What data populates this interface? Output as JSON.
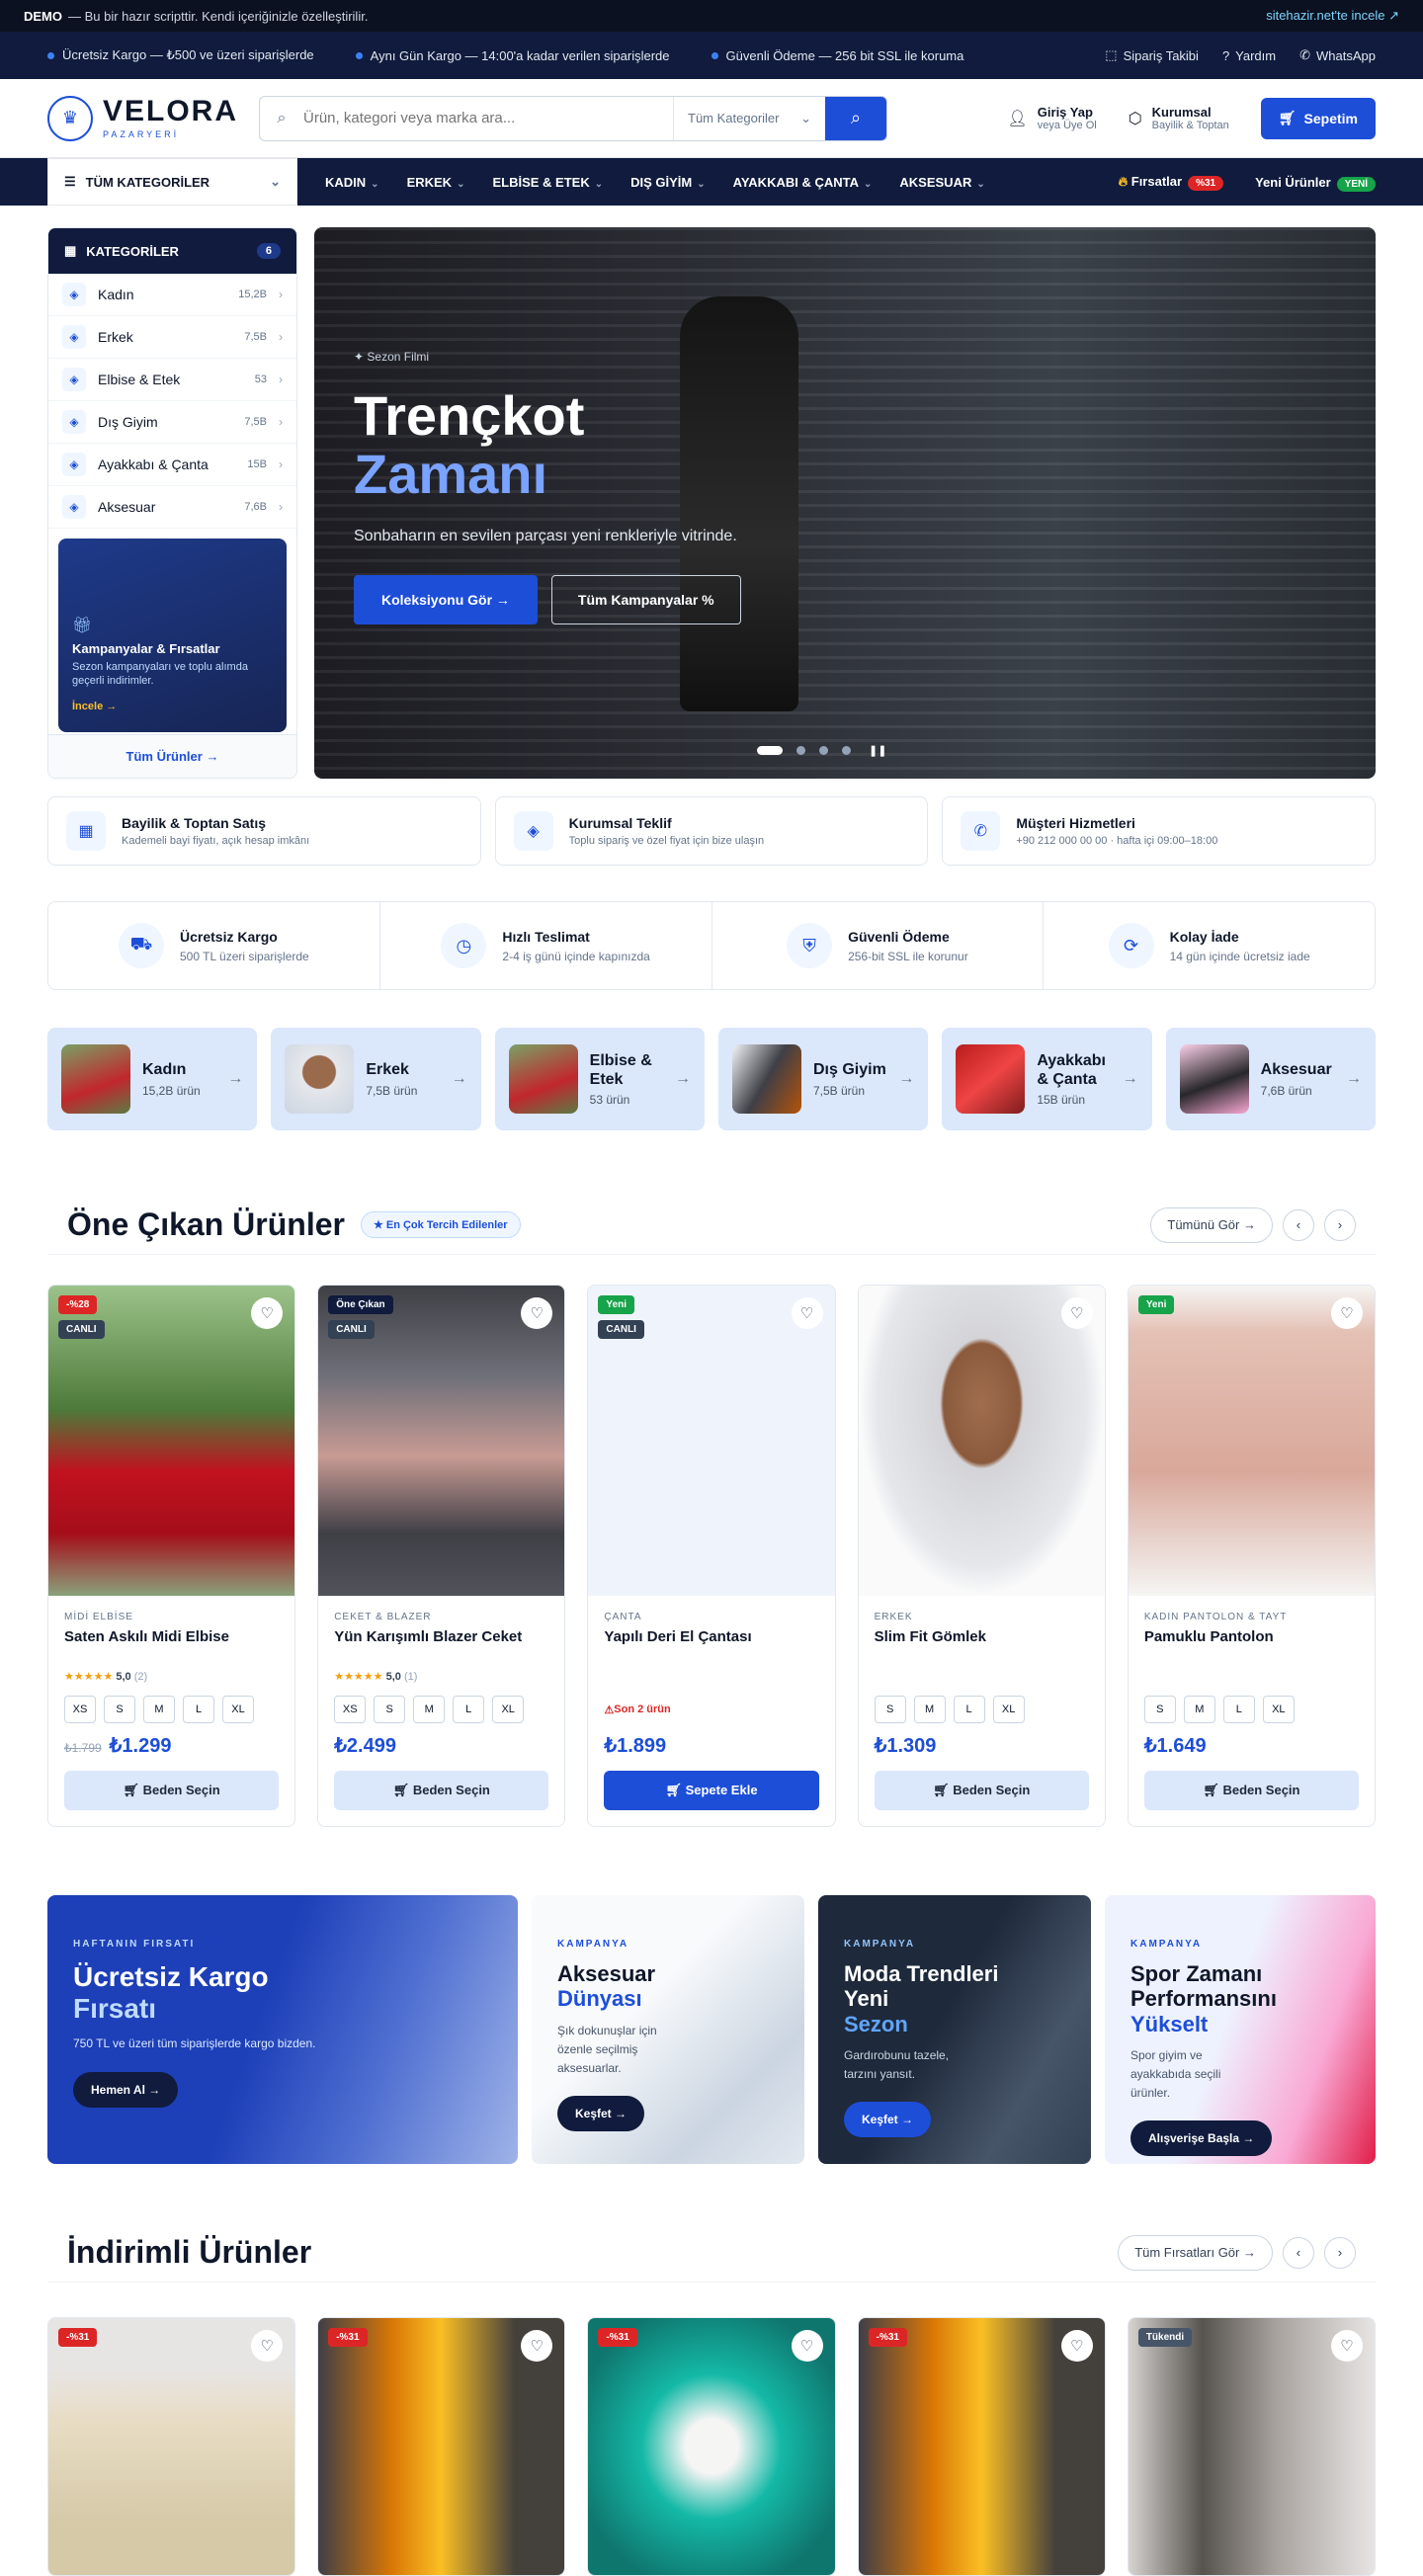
{
  "demo": {
    "label": "DEMO",
    "text": "— Bu bir hazır scripttir. Kendi içeriğinizle özelleştirilir.",
    "link": "sitehazir.net'te incele"
  },
  "ticker": {
    "items": [
      "Ücretsiz Kargo — ₺500 ve üzeri siparişlerde",
      "Aynı Gün Kargo — 14:00'a kadar verilen siparişlerde",
      "Güvenli Ödeme — 256 bit SSL ile koruma"
    ],
    "links": [
      "Sipariş Takibi",
      "Yardım",
      "WhatsApp"
    ]
  },
  "header": {
    "brand": "VELORA",
    "brand_sub": "PAZARYERİ",
    "search_placeholder": "Ürün, kategori veya marka ara...",
    "search_category": "Tüm Kategoriler",
    "login": "Giriş Yap",
    "login_sub": "veya Üye Ol",
    "corporate": "Kurumsal",
    "corporate_sub": "Bayilik & Toptan",
    "cart": "Sepetim"
  },
  "nav": {
    "all_categories": "TÜM KATEGORİLER",
    "links": [
      "KADIN",
      "ERKEK",
      "ELBİSE & ETEK",
      "DIŞ GİYİM",
      "AYAKKABI & ÇANTA",
      "AKSESUAR"
    ],
    "deals": "Fırsatlar",
    "deals_badge": "%31",
    "new": "Yeni Ürünler",
    "new_badge": "YENİ"
  },
  "sidebar": {
    "title": "KATEGORİLER",
    "count": "6",
    "items": [
      {
        "label": "Kadın",
        "count": "15,2B"
      },
      {
        "label": "Erkek",
        "count": "7,5B"
      },
      {
        "label": "Elbise & Etek",
        "count": "53"
      },
      {
        "label": "Dış Giyim",
        "count": "7,5B"
      },
      {
        "label": "Ayakkabı & Çanta",
        "count": "15B"
      },
      {
        "label": "Aksesuar",
        "count": "7,6B"
      }
    ],
    "promo_title": "Kampanyalar & Fırsatlar",
    "promo_desc": "Sezon kampanyaları ve toplu alımda geçerli indirimler.",
    "promo_link": "İncele",
    "all_products": "Tüm Ürünler"
  },
  "hero": {
    "tag": "Sezon Filmi",
    "title_1": "Trençkot",
    "title_2": "Zamanı",
    "desc": "Sonbaharın en sevilen parçası yeni renkleriyle vitrinde.",
    "btn_primary": "Koleksiyonu Gör",
    "btn_secondary": "Tüm Kampanyalar"
  },
  "services": [
    {
      "icon": "grid-icon",
      "title": "Bayilik & Toptan Satış",
      "desc": "Kademeli bayi fiyatı, açık hesap imkânı"
    },
    {
      "icon": "tag-icon",
      "title": "Kurumsal Teklif",
      "desc": "Toplu sipariş ve özel fiyat için bize ulaşın"
    },
    {
      "icon": "phone-icon",
      "title": "Müşteri Hizmetleri",
      "desc": "+90 212 000 00 00 · hafta içi 09:00–18:00"
    }
  ],
  "features": [
    {
      "icon": "truck-icon",
      "title": "Ücretsiz Kargo",
      "desc": "500 TL üzeri siparişlerde"
    },
    {
      "icon": "clock-icon",
      "title": "Hızlı Teslimat",
      "desc": "2-4 iş günü içinde kapınızda"
    },
    {
      "icon": "shield-icon",
      "title": "Güvenli Ödeme",
      "desc": "256-bit SSL ile korunur"
    },
    {
      "icon": "refresh-icon",
      "title": "Kolay İade",
      "desc": "14 gün içinde ücretsiz iade"
    }
  ],
  "categories": [
    {
      "title": "Kadın",
      "count": "15,2B ürün"
    },
    {
      "title": "Erkek",
      "count": "7,5B ürün"
    },
    {
      "title": "Elbise & Etek",
      "count": "53 ürün"
    },
    {
      "title": "Dış Giyim",
      "count": "7,5B ürün"
    },
    {
      "title": "Ayakkabı & Çanta",
      "count": "15B ürün"
    },
    {
      "title": "Aksesuar",
      "count": "7,6B ürün"
    }
  ],
  "featured": {
    "title": "Öne Çıkan Ürünler",
    "badge": "En Çok Tercih Edilenler",
    "see_all": "Tümünü Gör",
    "products": [
      {
        "cat": "MİDİ ELBİSE",
        "name": "Saten Askılı Midi Elbise",
        "rating": "5,0",
        "reviews": "(2)",
        "sizes": [
          "XS",
          "S",
          "M",
          "L",
          "XL"
        ],
        "old": "₺1.799",
        "price": "₺1.299",
        "button": "Beden Seçin",
        "labels": [
          "-%28",
          "CANLI"
        ]
      },
      {
        "cat": "CEKET & BLAZER",
        "name": "Yün Karışımlı Blazer Ceket",
        "rating": "5,0",
        "reviews": "(1)",
        "sizes": [
          "XS",
          "S",
          "M",
          "L",
          "XL"
        ],
        "old": "",
        "price": "₺2.499",
        "button": "Beden Seçin",
        "labels": [
          "Öne Çıkan",
          "CANLI"
        ]
      },
      {
        "cat": "ÇANTA",
        "name": "Yapılı Deri El Çantası",
        "stock": "Son 2 ürün",
        "old": "",
        "price": "₺1.899",
        "button": "Sepete Ekle",
        "labels": [
          "Yeni",
          "CANLI"
        ]
      },
      {
        "cat": "ERKEK",
        "name": "Slim Fit Gömlek",
        "sizes": [
          "S",
          "M",
          "L",
          "XL"
        ],
        "old": "",
        "price": "₺1.309",
        "button": "Beden Seçin",
        "labels": []
      },
      {
        "cat": "KADIN PANTOLON & TAYT",
        "name": "Pamuklu Pantolon",
        "sizes": [
          "S",
          "M",
          "L",
          "XL"
        ],
        "old": "",
        "price": "₺1.649",
        "button": "Beden Seçin",
        "labels": [
          "Yeni"
        ]
      }
    ]
  },
  "banners": [
    {
      "kicker": "HAFTANIN FIRSATI",
      "title": "Ücretsiz Kargo",
      "highlight": "Fırsatı",
      "desc": "750 TL ve üzeri tüm siparişlerde kargo bizden.",
      "button": "Hemen Al"
    },
    {
      "kicker": "KAMPANYA",
      "title": "Aksesuar",
      "highlight": "Dünyası",
      "desc": "Şık dokunuşlar için özenle seçilmiş aksesuarlar.",
      "button": "Keşfet"
    },
    {
      "kicker": "KAMPANYA",
      "title": "Moda Trendleri Yeni",
      "highlight": "Sezon",
      "desc": "Gardırobunu tazele, tarzını yansıt.",
      "button": "Keşfet"
    },
    {
      "kicker": "KAMPANYA",
      "title": "Spor Zamanı Performansını",
      "highlight": "Yükselt",
      "desc": "Spor giyim ve ayakkabıda seçili ürünler.",
      "button": "Alışverişe Başla"
    }
  ],
  "discounted": {
    "title": "İndirimli Ürünler",
    "see_all": "Tüm Fırsatları Gör",
    "labels": [
      "-%31",
      "-%31",
      "-%31",
      "-%31",
      "Tükendi"
    ]
  }
}
